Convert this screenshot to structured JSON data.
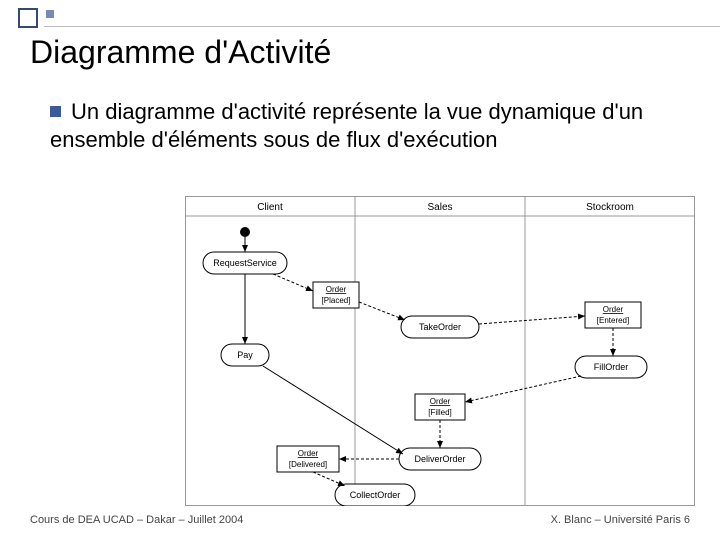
{
  "title": "Diagramme d'Activité",
  "bullet": "Un diagramme d'activité représente la vue dynamique d'un ensemble d'éléments sous de flux d'exécution",
  "footer_left": "Cours de DEA UCAD – Dakar – Juillet 2004",
  "footer_right": "X. Blanc – Université Paris 6",
  "diagram": {
    "swimlanes": [
      "Client",
      "Sales",
      "Stockroom"
    ],
    "activities": {
      "request": "RequestService",
      "pay": "Pay",
      "takeorder": "TakeOrder",
      "fillorder": "FillOrder",
      "deliverorder": "DeliverOrder",
      "collectorder": "CollectOrder"
    },
    "object_states": {
      "placed": {
        "name": "Order",
        "state": "[Placed]"
      },
      "entered": {
        "name": "Order",
        "state": "[Entered]"
      },
      "filled": {
        "name": "Order",
        "state": "[Filled]"
      },
      "delivered": {
        "name": "Order",
        "state": "[Delivered]"
      }
    }
  }
}
